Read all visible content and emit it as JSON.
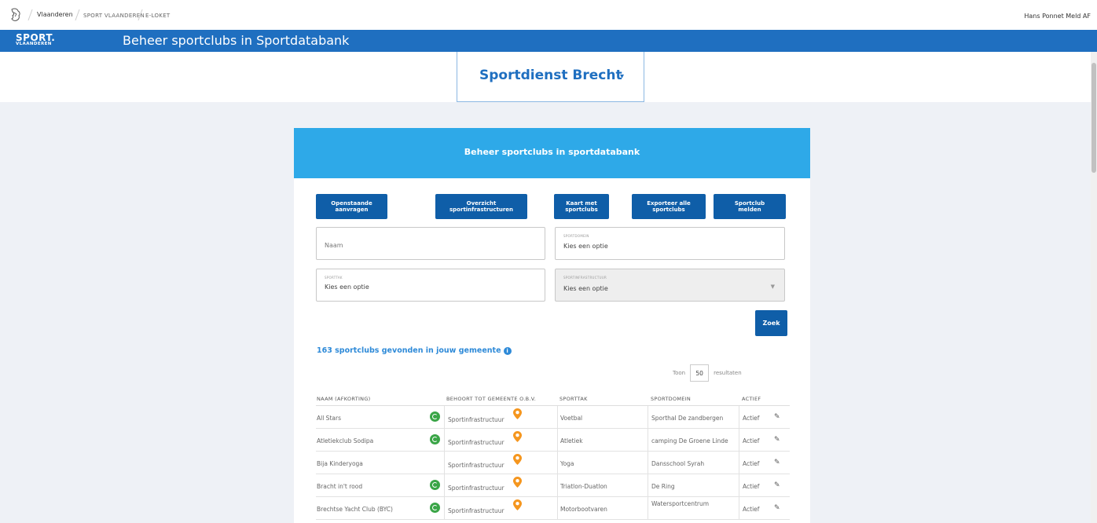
{
  "gov_bar": {
    "main": "Vlaanderen",
    "links": [
      "SPORT VLAANDEREN",
      "E-LOKET"
    ],
    "user": "Hans Ponnet Meld AF"
  },
  "app_bar": {
    "logo_line1": "SPORT.",
    "logo_line2": "VLAANDEREN",
    "title": "Beheer sportclubs in Sportdatabank"
  },
  "org_select": {
    "label": "Sportdienst Brecht",
    "caret": "▾"
  },
  "card": {
    "header": "Beheer sportclubs in sportdatabank",
    "buttons": [
      "Openstaande\naanvragen",
      "Overzicht\nsportinfrastructuren",
      "Kaart met\nsportclubs",
      "Exporteer alle\nsportclubs",
      "Sportclub\nmelden"
    ],
    "fields": {
      "naam_placeholder": "Naam",
      "sportdomein_label": "SPORTDOMEIN",
      "sportdomein_value": "Kies een optie",
      "sporttak_label": "SPORTTAK",
      "sporttak_value": "Kies een optie",
      "infra_label": "SPORTINFRASTRUCTUUR",
      "infra_value": "Kies een optie"
    },
    "zoek": "Zoek",
    "result_count": "163 sportclubs gevonden in jouw gemeente",
    "toon": {
      "before": "Toon",
      "value": "50",
      "after": "resultaten"
    },
    "table": {
      "headers": [
        "NAAM (AFKORTING)",
        "BEHOORT TOT GEMEENTE O.B.V.",
        "SPORTTAK",
        "SPORTDOMEIN",
        "ACTIEF"
      ],
      "rows": [
        {
          "naam": "All Stars",
          "check": true,
          "behoort": "Sportinfrastructuur",
          "sporttak": "Voetbal",
          "domein": "Sporthal De zandbergen",
          "actief": "Actief"
        },
        {
          "naam": "Atletiekclub Sodipa",
          "check": true,
          "behoort": "Sportinfrastructuur",
          "sporttak": "Atletiek",
          "domein": "camping De Groene Linde",
          "actief": "Actief"
        },
        {
          "naam": "Bija Kinderyoga",
          "check": false,
          "behoort": "Sportinfrastructuur",
          "sporttak": "Yoga",
          "domein": "Dansschool Syrah",
          "actief": "Actief"
        },
        {
          "naam": "Bracht in't rood",
          "check": true,
          "behoort": "Sportinfrastructuur",
          "sporttak": "Triatlon-Duatlon",
          "domein": "De Ring",
          "actief": "Actief"
        },
        {
          "naam": "Brechtse Yacht Club (BYC)",
          "check": true,
          "behoort": "Sportinfrastructuur",
          "sporttak": "Motorbootvaren",
          "domein": "Watersportcentrum",
          "actief": "Actief"
        }
      ]
    }
  },
  "colors": {
    "brand_blue": "#1f6fc0",
    "header_cyan": "#2ea9e8",
    "button_blue": "#0f5ea8",
    "check_green": "#3aa547",
    "pin_orange": "#f5961e"
  }
}
